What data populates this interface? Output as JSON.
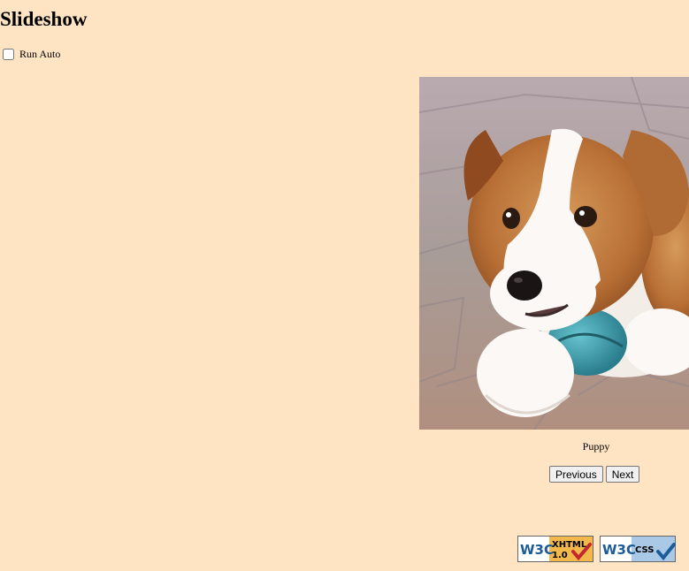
{
  "page": {
    "title": "Slideshow",
    "background": "#ffe4c4"
  },
  "controls": {
    "auto_label": "Run Auto",
    "auto_checked": false
  },
  "slide": {
    "caption": "Puppy",
    "image_alt": "Puppy"
  },
  "nav": {
    "previous_label": "Previous",
    "next_label": "Next"
  },
  "badges": {
    "xhtml": {
      "w3c": "W3C",
      "label": "XHTML",
      "version": "1.0"
    },
    "css": {
      "w3c": "W3C",
      "label": "CSS"
    }
  }
}
